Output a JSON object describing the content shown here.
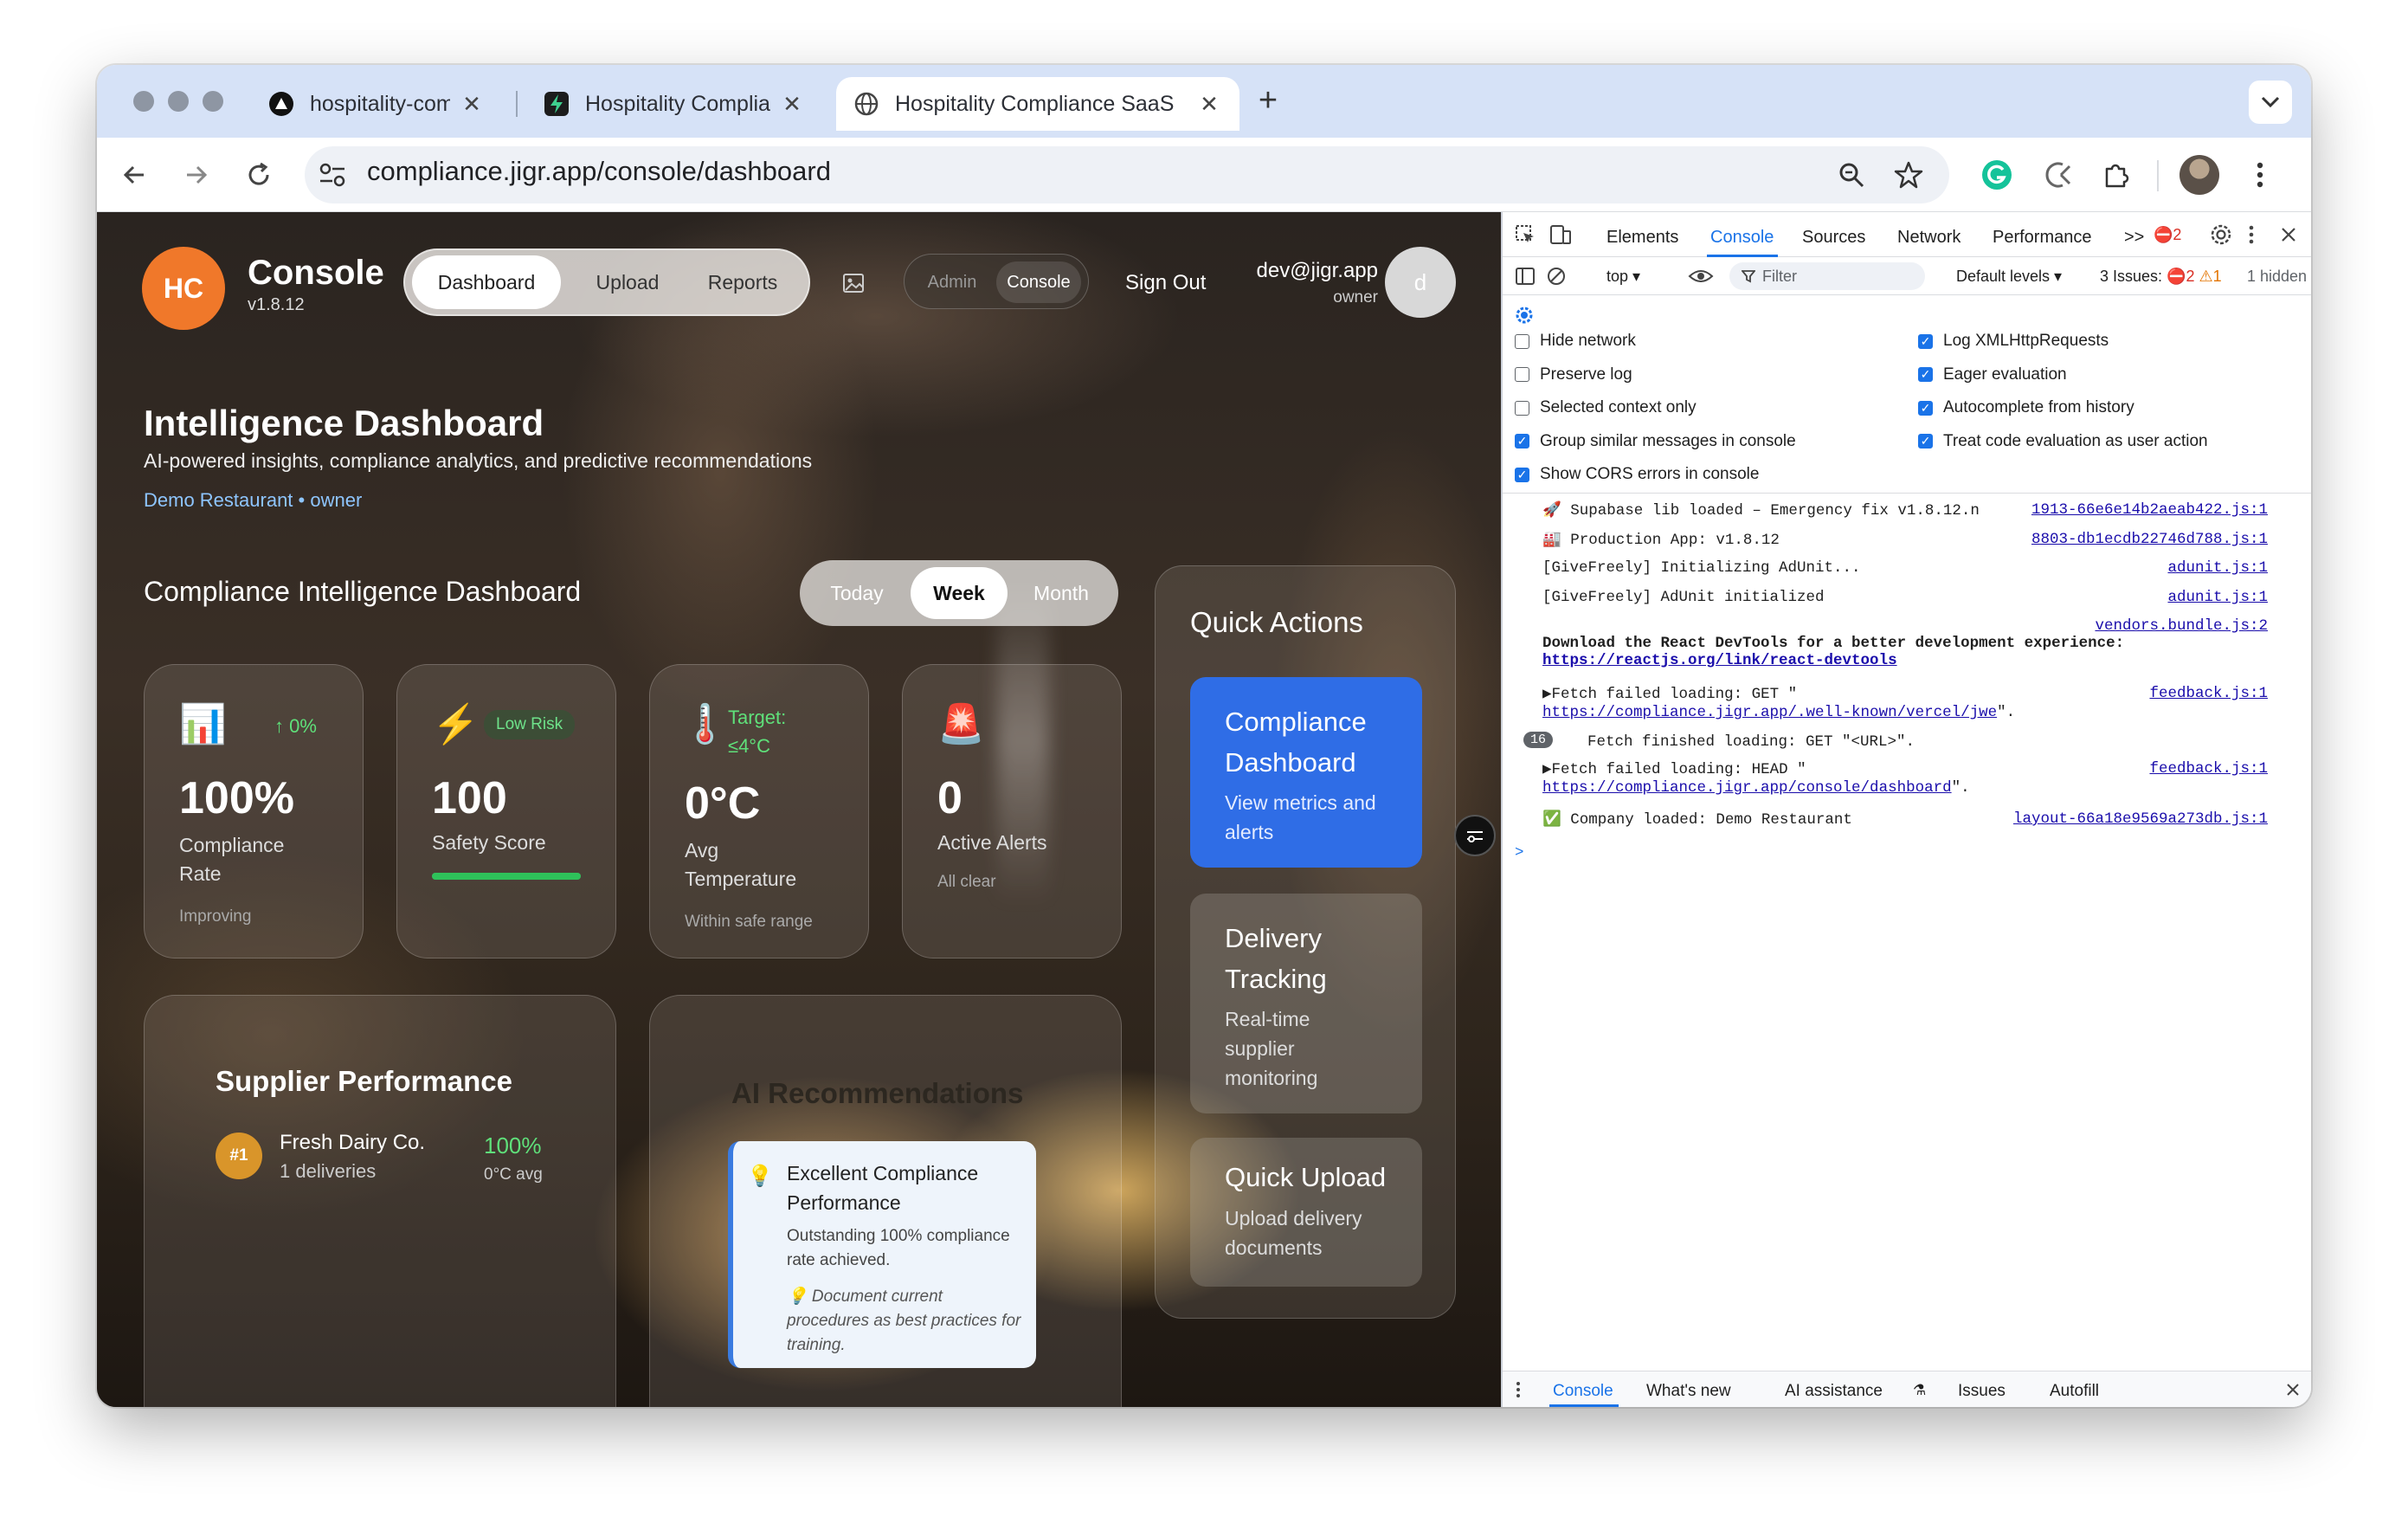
{
  "browser": {
    "tabs": [
      {
        "title": "hospitality-compliance – Dep",
        "close": "✕",
        "icon": "vercel-icon"
      },
      {
        "title": "Hospitality Compliance Apps",
        "close": "✕",
        "icon": "supabase-icon"
      },
      {
        "title": "Hospitality Compliance SaaS",
        "close": "✕",
        "icon": "globe-icon"
      }
    ],
    "new_tab": "+",
    "url": "compliance.jigr.app/console/dashboard"
  },
  "app": {
    "logo": "HC",
    "title": "Console",
    "version": "v1.8.12",
    "nav": [
      "Dashboard",
      "Upload",
      "Reports"
    ],
    "mode": [
      "Admin",
      "Console"
    ],
    "sign_out": "Sign Out",
    "user": {
      "email": "dev@jigr.app",
      "role": "owner",
      "avatar": "d"
    },
    "page_title": "Intelligence Dashboard",
    "page_subtitle": "AI-powered insights, compliance analytics, and predictive recommendations",
    "company": "Demo Restaurant",
    "company_sep": "•",
    "company_role": "owner",
    "section_title": "Compliance Intelligence Dashboard",
    "period": [
      "Today",
      "Week",
      "Month"
    ],
    "stats": [
      {
        "icon": "📊",
        "badge": "↑ 0%",
        "value": "100%",
        "label": "Compliance Rate",
        "sub": "Improving"
      },
      {
        "icon": "⚡",
        "badge": "Low Risk",
        "value": "100",
        "label": "Safety Score",
        "sub": "",
        "progress": 1.0
      },
      {
        "icon": "🌡️",
        "badge": "Target: ≤4°C",
        "value": "0°C",
        "label": "Avg Temperature",
        "sub": "Within safe range"
      },
      {
        "icon": "🚨",
        "badge": "",
        "value": "0",
        "label": "Active Alerts",
        "sub": "All clear"
      }
    ],
    "supplier": {
      "title": "Supplier Performance",
      "rank": "#1",
      "name": "Fresh Dairy Co.",
      "deliveries": "1 deliveries",
      "pct": "100%",
      "avg": "0°C avg"
    },
    "ai": {
      "title": "AI Recommendations",
      "rec_title": "Excellent Compliance Performance",
      "rec_text": "Outstanding 100% compliance rate achieved.",
      "rec_tip": "💡 Document current procedures as best practices for training.",
      "icon": "💡"
    },
    "quick": {
      "title": "Quick Actions",
      "items": [
        {
          "title": "Compliance Dashboard",
          "desc": "View metrics and alerts"
        },
        {
          "title": "Delivery Tracking",
          "desc": "Real-time supplier monitoring"
        },
        {
          "title": "Quick Upload",
          "desc": "Upload delivery documents"
        }
      ]
    }
  },
  "devtools": {
    "tabs": [
      "Elements",
      "Console",
      "Sources",
      "Network",
      "Performance"
    ],
    "more": ">>",
    "error_count": "2",
    "context": "top ▾",
    "filter": "Filter",
    "levels": "Default levels ▾",
    "issues_label": "3 Issues:",
    "issues_err": "2",
    "issues_warn": "1",
    "hidden": "1 hidden",
    "settings_left": [
      "Hide network",
      "Preserve log",
      "Selected context only",
      "Group similar messages in console",
      "Show CORS errors in console"
    ],
    "settings_right": [
      "Log XMLHttpRequests",
      "Eager evaluation",
      "Autocomplete from history",
      "Treat code evaluation as user action"
    ],
    "logs": [
      {
        "text": "🚀 Supabase lib loaded – Emergency fix v1.8.12.n",
        "src": "1913-66e6e14b2aeab422.js:1"
      },
      {
        "text": "🏭 Production App: v1.8.12",
        "src": "8803-db1ecdb22746d788.js:1"
      },
      {
        "text": "[GiveFreely] Initializing AdUnit...",
        "src": "adunit.js:1"
      },
      {
        "text": "[GiveFreely] AdUnit initialized",
        "src": "adunit.js:1"
      },
      {
        "src": "vendors.bundle.js:2"
      },
      {
        "text": "Download the React DevTools for a better development experience:",
        "link": "https://reactjs.org/link/react-devtools"
      },
      {
        "text": "▶Fetch failed loading: GET \"",
        "link": "https://compliance.jigr.app/.well-known/vercel/jwe",
        "tail": "\".",
        "src": "feedback.js:1"
      },
      {
        "count": "16",
        "text": "Fetch finished loading: GET \"<URL>\"."
      },
      {
        "text": "▶Fetch failed loading: HEAD \"",
        "link": "https://compliance.jigr.app/console/dashboard",
        "tail": "\".",
        "src": "feedback.js:1"
      },
      {
        "text": "✅ Company loaded: Demo Restaurant",
        "src": "layout-66a18e9569a273db.js:1"
      }
    ],
    "prompt": ">",
    "drawer": [
      "Console",
      "What's new",
      "AI assistance",
      "Issues",
      "Autofill"
    ]
  }
}
